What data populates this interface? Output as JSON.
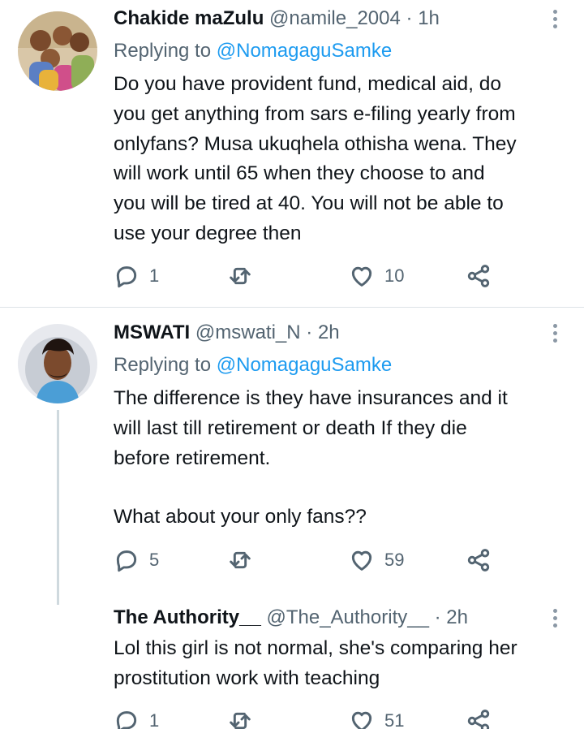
{
  "tweets": [
    {
      "name": "Chakide maZulu",
      "handle": "@namile_2004",
      "dot": "·",
      "time": "1h",
      "replying_prefix": "Replying to",
      "replying_to": "@NomagaguSamke",
      "lines": [
        "Do you have provident fund, medical aid, do",
        "you get anything from sars e-filing yearly from",
        "onlyfans? Musa ukuqhela othisha wena. They",
        "will work until 65 when they choose to and",
        "you will be tired at 40. You will not be able to",
        "use your degree then"
      ],
      "replies": "1",
      "retweets": "",
      "likes": "10"
    },
    {
      "name": "MSWATI",
      "handle": "@mswati_N",
      "dot": "·",
      "time": "2h",
      "replying_prefix": "Replying to",
      "replying_to": "@NomagaguSamke",
      "lines": [
        "The difference is they have insurances and it",
        "will last till retirement or death If they die",
        "before retirement."
      ],
      "extra_line": "What about your only fans??",
      "replies": "5",
      "retweets": "",
      "likes": "59"
    },
    {
      "name": "The Authority__",
      "handle": "@The_Authority__",
      "dot": "·",
      "time": "2h",
      "lines": [
        "Lol this girl is not normal, she's comparing her",
        "prostitution work with teaching"
      ],
      "replies": "1",
      "retweets": "",
      "likes": "51"
    }
  ],
  "icons": {
    "reply": "reply-icon",
    "retweet": "retweet-icon",
    "like": "heart-icon",
    "share": "share-icon",
    "more": "more-icon"
  },
  "colors": {
    "link": "#1d9bf0",
    "muted": "#536471",
    "thread_line": "#cfd9de"
  }
}
